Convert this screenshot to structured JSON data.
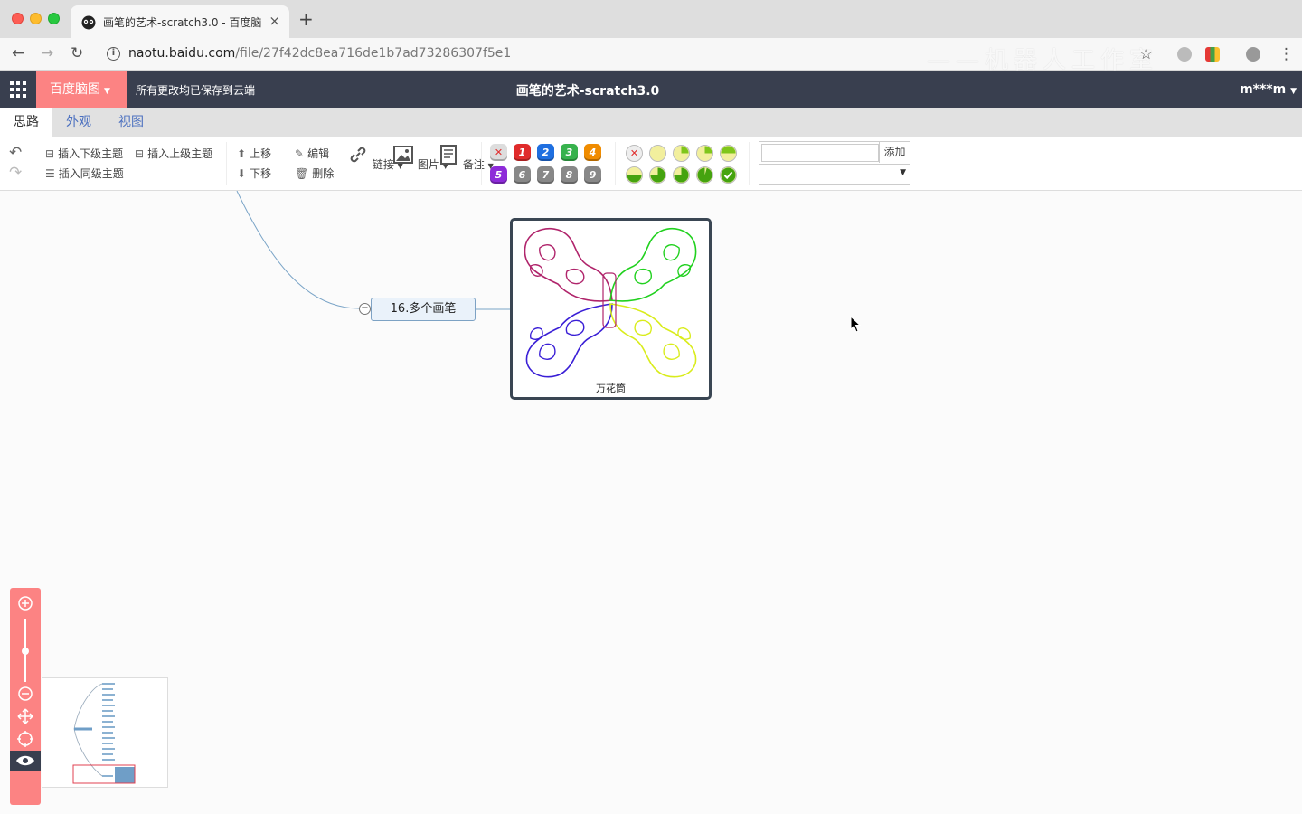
{
  "browser": {
    "tab_title": "画笔的艺术-scratch3.0 - 百度脑",
    "url_domain": "naotu.baidu.com",
    "url_path": "/file/27f42dc8ea716de1b7ad73286307f5e1",
    "watermark": "——机器人工作室"
  },
  "app": {
    "brand": "百度脑图",
    "saved_status": "所有更改均已保存到云端",
    "doc_title": "画笔的艺术-scratch3.0",
    "user": "m***m"
  },
  "tabs": [
    {
      "label": "思路",
      "active": true
    },
    {
      "label": "外观",
      "active": false
    },
    {
      "label": "视图",
      "active": false
    }
  ],
  "toolbar": {
    "insert_child": "插入下级主题",
    "insert_parent": "插入上级主题",
    "insert_sibling": "插入同级主题",
    "move_up": "上移",
    "move_down": "下移",
    "edit": "编辑",
    "delete": "删除",
    "link": "链接",
    "image": "图片",
    "note": "备注",
    "priority_colors": [
      "#e02b2b",
      "#1f6fe0",
      "#37b24d",
      "#f08c00",
      "#8e2bd9",
      "#888888"
    ],
    "priorities_row1": [
      "1",
      "2",
      "3",
      "4"
    ],
    "priorities_row2": [
      "5",
      "6",
      "7",
      "8",
      "9"
    ],
    "resource_add": "添加"
  },
  "canvas": {
    "node_label": "16.多个画笔",
    "image_caption": "万花筒"
  }
}
